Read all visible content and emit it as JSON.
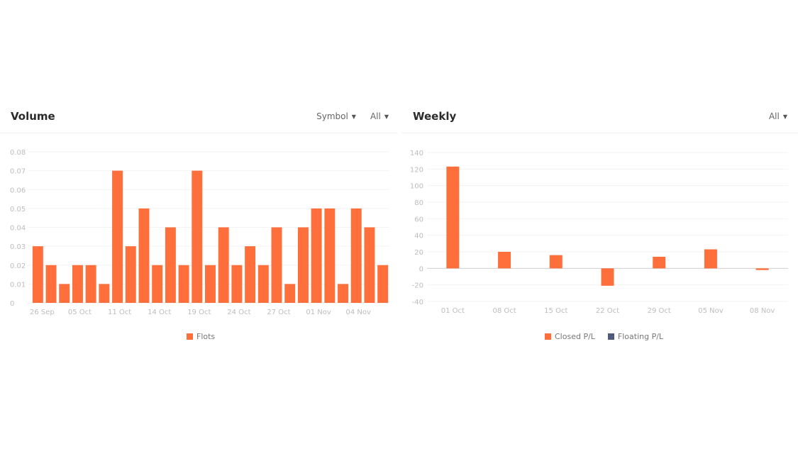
{
  "volume_panel": {
    "title": "Volume",
    "controls": [
      {
        "label": "Symbol",
        "icon": "caret-down-icon"
      },
      {
        "label": "All",
        "icon": "caret-down-icon"
      }
    ]
  },
  "weekly_panel": {
    "title": "Weekly",
    "controls": [
      {
        "label": "All",
        "icon": "caret-down-icon"
      }
    ]
  },
  "colors": {
    "closed": "#ff6f3c",
    "floating": "#4e5a7e",
    "grid": "#f3f3f3",
    "axis_text": "#bdbdbd",
    "zero_line": "#cfcfcf"
  },
  "chart_data": [
    {
      "type": "bar",
      "title": "Volume",
      "xlabel": "",
      "ylabel": "",
      "ylim": [
        0,
        0.08
      ],
      "yticks": [
        "0",
        "0.01",
        "0.02",
        "0.03",
        "0.04",
        "0.05",
        "0.06",
        "0.07",
        "0.08"
      ],
      "x_tick_labels": [
        {
          "index": 0,
          "label": "26 Sep"
        },
        {
          "index": 3,
          "label": "05 Oct"
        },
        {
          "index": 6,
          "label": "11 Oct"
        },
        {
          "index": 9,
          "label": "14 Oct"
        },
        {
          "index": 12,
          "label": "19 Oct"
        },
        {
          "index": 15,
          "label": "24 Oct"
        },
        {
          "index": 18,
          "label": "27 Oct"
        },
        {
          "index": 21,
          "label": "01 Nov"
        },
        {
          "index": 24,
          "label": "04 Nov"
        }
      ],
      "grid": true,
      "legend_position": "bottom",
      "series": [
        {
          "name": "Flots",
          "values": [
            0.03,
            0.02,
            0.01,
            0.02,
            0.02,
            0.01,
            0.07,
            0.03,
            0.05,
            0.02,
            0.04,
            0.02,
            0.07,
            0.02,
            0.04,
            0.02,
            0.03,
            0.02,
            0.04,
            0.01,
            0.04,
            0.05,
            0.05,
            0.01,
            0.05,
            0.04,
            0.02
          ]
        }
      ]
    },
    {
      "type": "bar",
      "title": "Weekly",
      "xlabel": "",
      "ylabel": "",
      "ylim": [
        -40,
        140
      ],
      "yticks": [
        "-40",
        "-20",
        "0",
        "20",
        "40",
        "60",
        "80",
        "100",
        "120",
        "140"
      ],
      "categories": [
        "01 Oct",
        "08 Oct",
        "15 Oct",
        "22 Oct",
        "29 Oct",
        "05 Nov",
        "08 Nov"
      ],
      "grid": true,
      "legend_position": "bottom",
      "series": [
        {
          "name": "Closed P/L",
          "values": [
            123,
            20,
            16,
            -21,
            14,
            23,
            -2
          ]
        },
        {
          "name": "Floating P/L",
          "values": [
            0,
            0,
            0,
            0,
            0,
            0,
            0
          ]
        }
      ]
    }
  ]
}
